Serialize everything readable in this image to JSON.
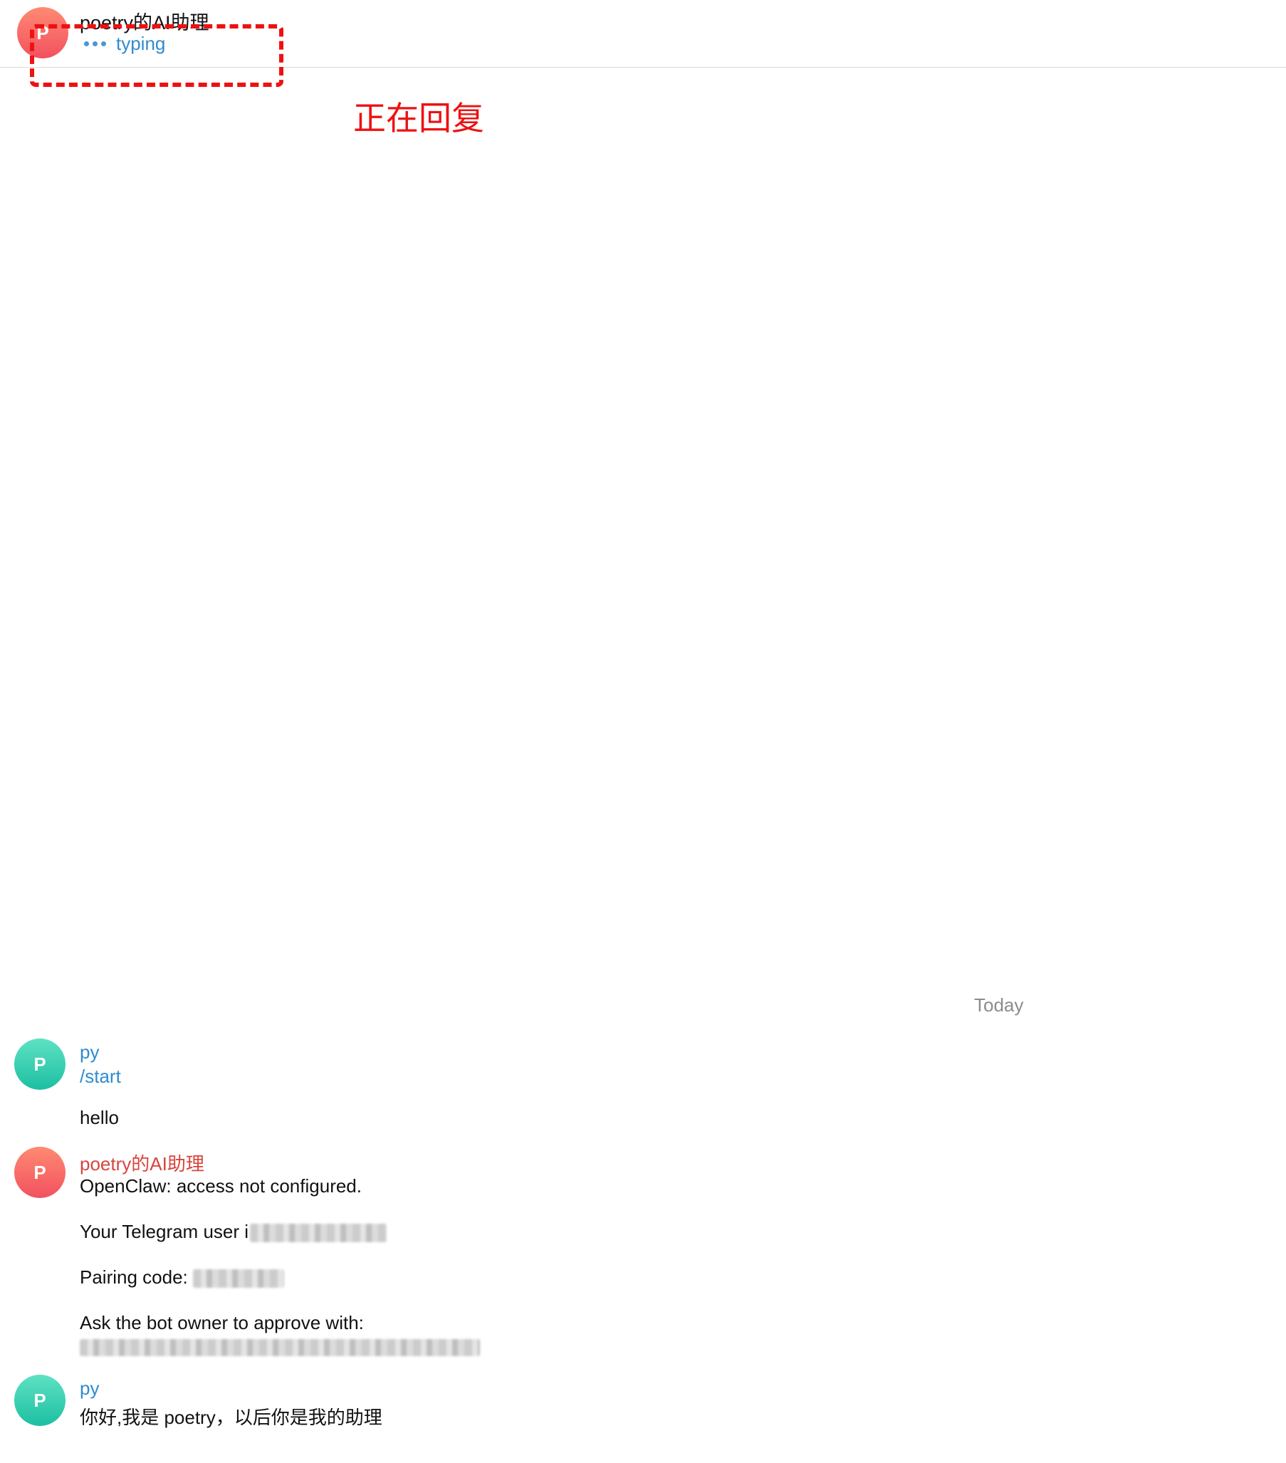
{
  "header": {
    "avatar_letter": "P",
    "title": "poetry的AI助理",
    "status": "typing"
  },
  "annotation": {
    "label": "正在回复",
    "color": "#ee1111"
  },
  "date_separator": "Today",
  "messages": [
    {
      "sender": "py",
      "avatar_letter": "P",
      "lines": [
        "/start",
        "hello"
      ]
    },
    {
      "sender": "poetry的AI助理",
      "avatar_letter": "P",
      "lines": [
        "OpenClaw: access not configured.",
        "Your Telegram user i",
        "Pairing code: ",
        "Ask the bot owner to approve with:"
      ]
    },
    {
      "sender": "py",
      "avatar_letter": "P",
      "lines": [
        "你好,我是 poetry，以后你是我的助理"
      ]
    }
  ],
  "colors": {
    "user_accent": "#2f8bd0",
    "bot_accent": "#d9443e",
    "user_avatar": "#1dbfa3",
    "bot_avatar": "#f2515f"
  },
  "icons": {
    "typing_indicator": "typing-dots-icon"
  }
}
